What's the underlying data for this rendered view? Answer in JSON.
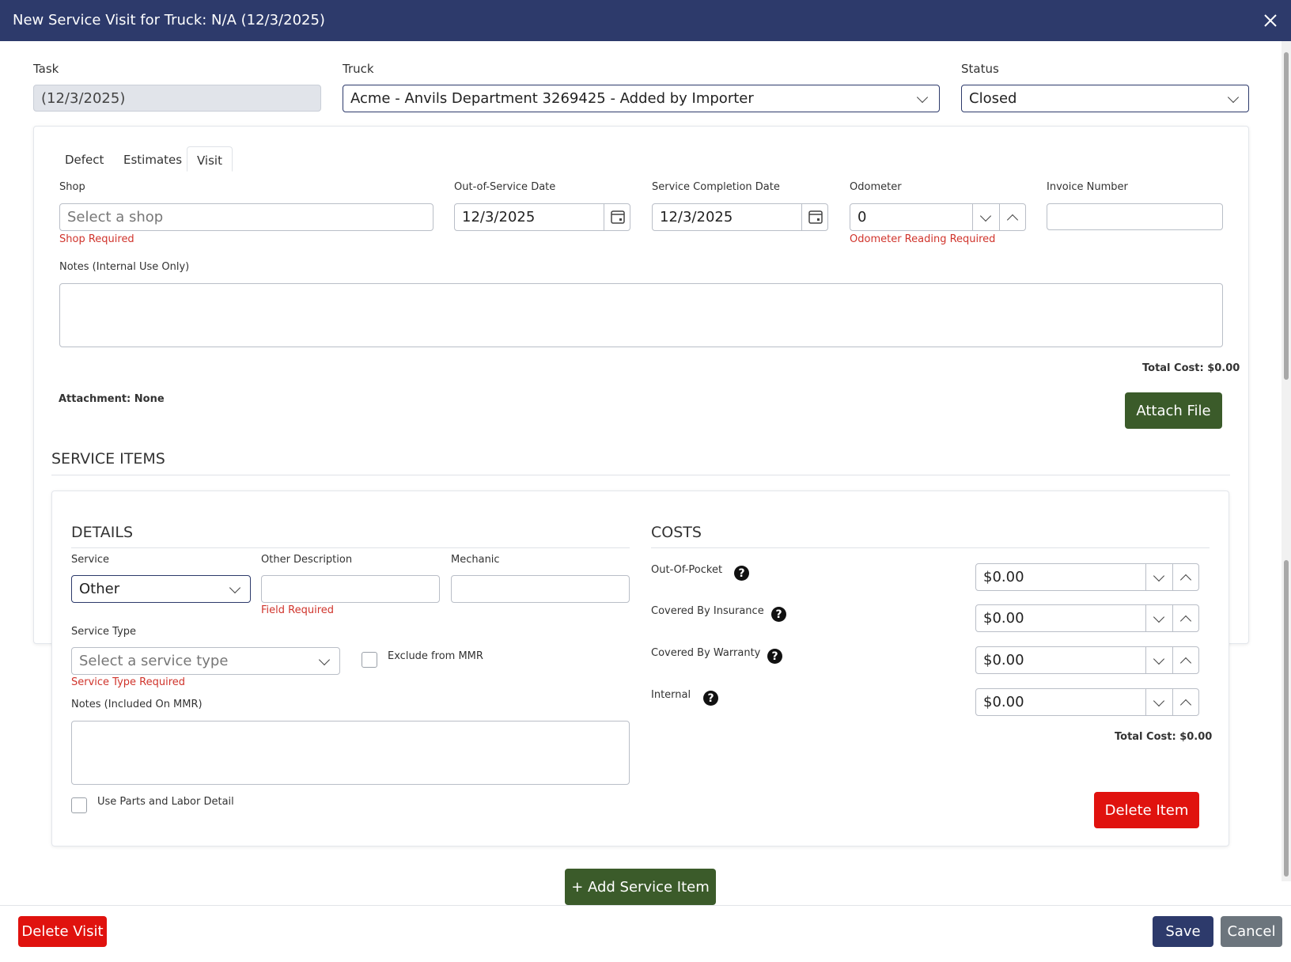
{
  "dialog": {
    "title": "New Service Visit for Truck: N/A (12/3/2025)"
  },
  "header_fields": {
    "task_label": "Task",
    "task_value": "(12/3/2025)",
    "truck_label": "Truck",
    "truck_value": "Acme - Anvils Department 3269425 - Added by Importer",
    "status_label": "Status",
    "status_value": "Closed"
  },
  "tabs": [
    {
      "label": "Defect"
    },
    {
      "label": "Estimates"
    },
    {
      "label": "Visit"
    }
  ],
  "visit": {
    "shop_label": "Shop",
    "shop_placeholder": "Select a shop",
    "shop_error": "Shop Required",
    "oos_label": "Out-of-Service Date",
    "oos_value": "12/3/2025",
    "completion_label": "Service Completion Date",
    "completion_value": "12/3/2025",
    "odometer_label": "Odometer",
    "odometer_value": "0",
    "odometer_error": "Odometer Reading Required",
    "invoice_label": "Invoice Number",
    "invoice_value": "",
    "notes_label": "Notes (Internal Use Only)",
    "total_cost": "Total Cost: $0.00",
    "attachment": "Attachment: None",
    "attach_button": "Attach File"
  },
  "service_items": {
    "title": "SERVICE ITEMS",
    "details_title": "DETAILS",
    "service_label": "Service",
    "service_value": "Other",
    "other_desc_label": "Other Description",
    "other_desc_error": "Field Required",
    "mechanic_label": "Mechanic",
    "service_type_label": "Service Type",
    "service_type_placeholder": "Select a service type",
    "service_type_error": "Service Type Required",
    "exclude_label": "Exclude from MMR",
    "notes_label": "Notes (Included On MMR)",
    "parts_labor_label": "Use Parts and Labor Detail",
    "costs_title": "COSTS",
    "costs": [
      {
        "label": "Out-Of-Pocket",
        "value": "$0.00"
      },
      {
        "label": "Covered By Insurance",
        "value": "$0.00"
      },
      {
        "label": "Covered By Warranty",
        "value": "$0.00"
      },
      {
        "label": "Internal",
        "value": "$0.00"
      }
    ],
    "total_cost": "Total Cost: $0.00",
    "delete_item_button": "Delete Item",
    "add_item_button": "+ Add Service Item"
  },
  "footer": {
    "delete_visit": "Delete Visit",
    "save": "Save",
    "cancel": "Cancel"
  },
  "colors": {
    "navy": "#2d3a6b",
    "green": "#3b5b2a",
    "red": "#e0120e",
    "grey": "#6c757d",
    "error": "#d0342c"
  }
}
